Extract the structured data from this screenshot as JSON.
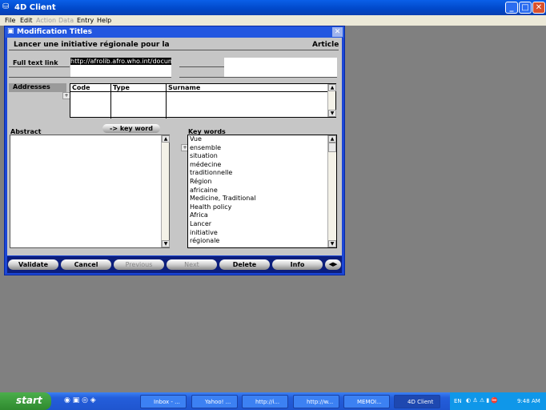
{
  "app": {
    "title": "4D Client"
  },
  "menu": [
    {
      "label": "File",
      "enabled": true
    },
    {
      "label": "Edit",
      "enabled": true
    },
    {
      "label": "Action",
      "enabled": false
    },
    {
      "label": "Data",
      "enabled": false
    },
    {
      "label": "Entry",
      "enabled": true
    },
    {
      "label": "Help",
      "enabled": true
    }
  ],
  "window": {
    "title": "Modification Titles",
    "record_title": "Lancer une initiative régionale pour la",
    "record_type": "Article",
    "full_text_link_label": "Full text link",
    "full_text_link_value": "http://afrolib.afro.who.int/document",
    "addresses_label": "Addresses",
    "addresses_columns": [
      "Code",
      "Type",
      "Surname"
    ],
    "key_word_button": "-> key word",
    "abstract_label": "Abstract",
    "abstract_value": "",
    "keywords_label": "Key words",
    "keywords": [
      "Vue",
      "ensemble",
      "situation",
      "médecine",
      "traditionnelle",
      "Région",
      "africaine",
      "Medicine, Traditional",
      "Health policy",
      "Africa",
      "Lancer",
      "initiative",
      "régionale"
    ]
  },
  "buttons": [
    {
      "label": "Validate",
      "enabled": true
    },
    {
      "label": "Cancel",
      "enabled": true
    },
    {
      "label": "Previous",
      "enabled": false
    },
    {
      "label": "Next",
      "enabled": false
    },
    {
      "label": "Delete",
      "enabled": true
    },
    {
      "label": "Info",
      "enabled": true
    }
  ],
  "taskbar": {
    "start": "start",
    "tasks": [
      {
        "label": "Inbox - ..."
      },
      {
        "label": "Yahoo! ..."
      },
      {
        "label": "http://i..."
      },
      {
        "label": "http://w..."
      },
      {
        "label": "MEMOI..."
      },
      {
        "label": "4D Client",
        "active": true
      }
    ],
    "lang": "EN",
    "clock": "9:48 AM"
  }
}
